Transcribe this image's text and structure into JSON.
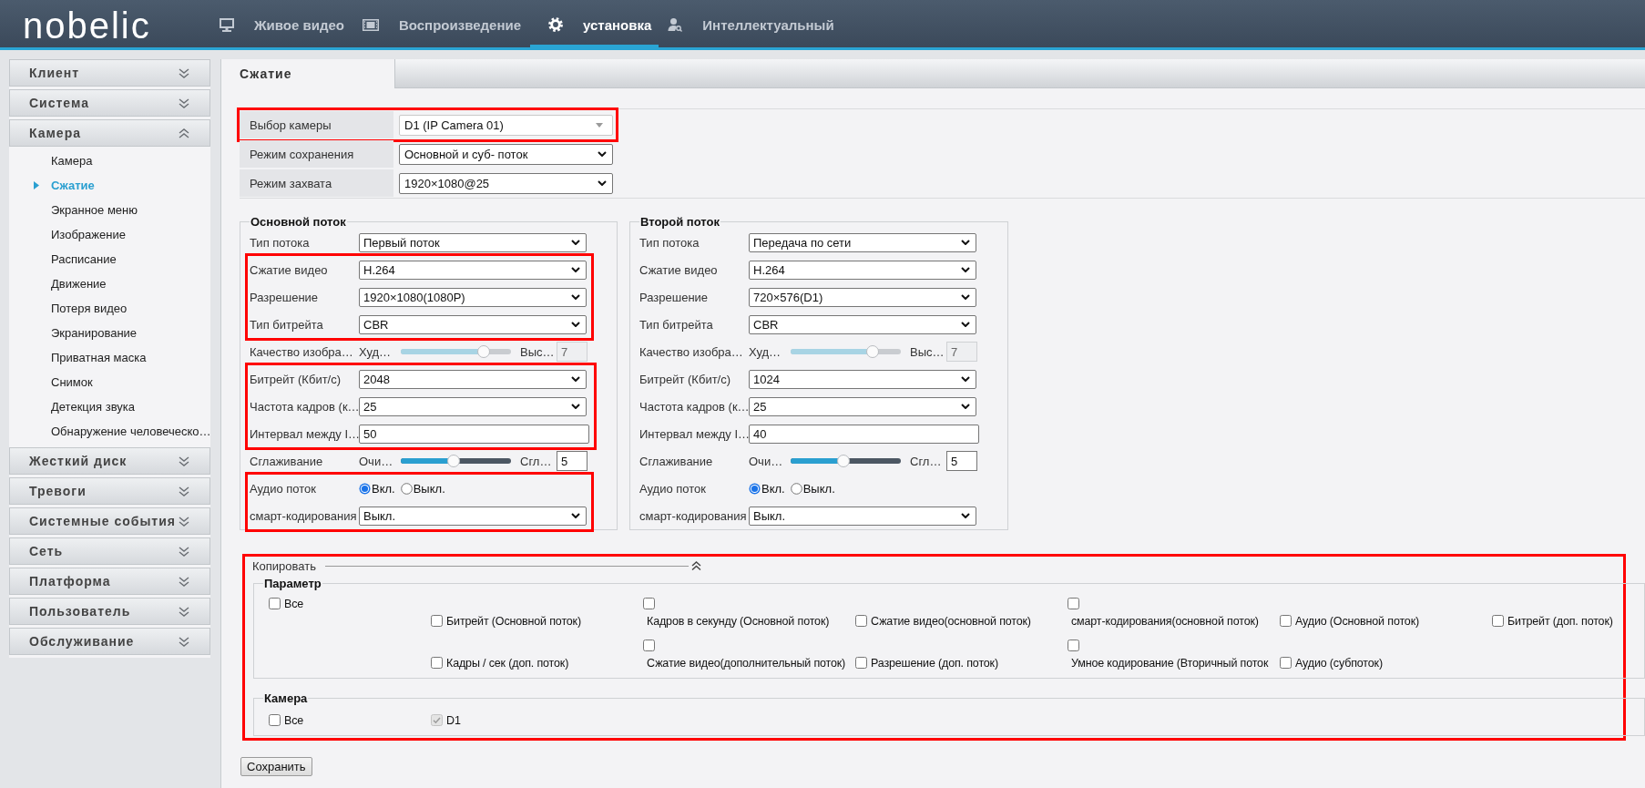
{
  "header": {
    "logo": "nobelic",
    "nav": [
      {
        "label": "Живое видео",
        "kind": "live",
        "selected": false
      },
      {
        "label": "Воспроизведение",
        "kind": "playback",
        "selected": false
      },
      {
        "label": "установка",
        "kind": "setup",
        "selected": true
      },
      {
        "label": "Интеллектуальный",
        "kind": "smart",
        "selected": false
      }
    ]
  },
  "sidebar": {
    "sections": [
      {
        "label": "Клиент",
        "expanded": false
      },
      {
        "label": "Система",
        "expanded": false
      },
      {
        "label": "Камера",
        "expanded": true,
        "items": [
          {
            "label": "Камера",
            "selected": false
          },
          {
            "label": "Сжатие",
            "selected": true
          },
          {
            "label": "Экранное меню",
            "selected": false
          },
          {
            "label": "Изображение",
            "selected": false
          },
          {
            "label": "Расписание",
            "selected": false
          },
          {
            "label": "Движение",
            "selected": false
          },
          {
            "label": "Потеря видео",
            "selected": false
          },
          {
            "label": "Экранирование",
            "selected": false
          },
          {
            "label": "Приватная маска",
            "selected": false
          },
          {
            "label": "Снимок",
            "selected": false
          },
          {
            "label": "Детекция звука",
            "selected": false
          },
          {
            "label": "Обнаружение человеческо…",
            "selected": false
          }
        ]
      },
      {
        "label": "Жесткий диск",
        "expanded": false
      },
      {
        "label": "Тревоги",
        "expanded": false
      },
      {
        "label": "Системные события",
        "expanded": false
      },
      {
        "label": "Сеть",
        "expanded": false
      },
      {
        "label": "Платформа",
        "expanded": false
      },
      {
        "label": "Пользователь",
        "expanded": false
      },
      {
        "label": "Обслуживание",
        "expanded": false
      }
    ]
  },
  "tabs": [
    {
      "label": "Сжатие",
      "selected": true
    }
  ],
  "general": {
    "groups": [
      {
        "highlighted": true,
        "rows": [
          {
            "kind": "combo",
            "label": "Выбор камеры",
            "value": "D1 (IP Camera 01)"
          }
        ]
      },
      {
        "highlighted": false,
        "rows": [
          {
            "kind": "select",
            "label": "Режим сохранения",
            "value": "Основной и суб- поток"
          },
          {
            "kind": "select",
            "label": "Режим захвата",
            "value": "1920×1080@25"
          }
        ]
      }
    ]
  },
  "streams": [
    {
      "title": "Основной поток",
      "groups": [
        {
          "highlighted": false,
          "rows": [
            {
              "kind": "select",
              "label": "Тип потока",
              "value": "Первый поток"
            }
          ]
        },
        {
          "highlighted": true,
          "rows": [
            {
              "kind": "select",
              "label": "Сжатие видео",
              "value": "H.264"
            },
            {
              "kind": "select",
              "label": "Разрешение",
              "value": "1920×1080(1080P)"
            },
            {
              "kind": "select",
              "label": "Тип битрейта",
              "value": "CBR"
            }
          ]
        },
        {
          "highlighted": false,
          "rows": [
            {
              "kind": "slider",
              "label": "Качество изобра…",
              "min_label": "Худ…",
              "max_label": "Выс…",
              "level": 0.75,
              "value": "7",
              "disabled": true
            }
          ]
        },
        {
          "highlighted": true,
          "rows": [
            {
              "kind": "select",
              "label": "Битрейт (Кбит/с)",
              "value": "2048"
            },
            {
              "kind": "select",
              "label": "Частота кадров (к…",
              "value": "25"
            },
            {
              "kind": "input",
              "label": "Интервал между I…",
              "value": "50"
            }
          ]
        },
        {
          "highlighted": false,
          "rows": [
            {
              "kind": "slider",
              "label": "Сглаживание",
              "min_label": "Очи…",
              "max_label": "Сгл…",
              "level": 0.48,
              "value": "5",
              "disabled": false
            }
          ]
        },
        {
          "highlighted": true,
          "rows": [
            {
              "kind": "radio",
              "label": "Аудио поток",
              "options": [
                {
                  "label": "Вкл.",
                  "selected": true
                },
                {
                  "label": "Выкл.",
                  "selected": false
                }
              ]
            },
            {
              "kind": "select",
              "label": "смарт-кодирования",
              "value": "Выкл."
            }
          ]
        }
      ]
    },
    {
      "title": "Второй поток",
      "groups": [
        {
          "highlighted": false,
          "rows": [
            {
              "kind": "select",
              "label": "Тип потока",
              "value": "Передача по сети"
            }
          ]
        },
        {
          "highlighted": false,
          "rows": [
            {
              "kind": "select",
              "label": "Сжатие видео",
              "value": "H.264"
            },
            {
              "kind": "select",
              "label": "Разрешение",
              "value": "720×576(D1)"
            },
            {
              "kind": "select",
              "label": "Тип битрейта",
              "value": "CBR"
            }
          ]
        },
        {
          "highlighted": false,
          "rows": [
            {
              "kind": "slider",
              "label": "Качество изобра…",
              "min_label": "Худ…",
              "max_label": "Выс…",
              "level": 0.74,
              "value": "7",
              "disabled": true
            }
          ]
        },
        {
          "highlighted": false,
          "rows": [
            {
              "kind": "select",
              "label": "Битрейт (Кбит/с)",
              "value": "1024"
            },
            {
              "kind": "select",
              "label": "Частота кадров (к…",
              "value": "25"
            },
            {
              "kind": "input",
              "label": "Интервал между I…",
              "value": "40"
            }
          ]
        },
        {
          "highlighted": false,
          "rows": [
            {
              "kind": "slider",
              "label": "Сглаживание",
              "min_label": "Очи…",
              "max_label": "Сгл…",
              "level": 0.48,
              "value": "5",
              "disabled": false
            }
          ]
        },
        {
          "highlighted": false,
          "rows": [
            {
              "kind": "radio",
              "label": "Аудио поток",
              "options": [
                {
                  "label": "Вкл.",
                  "selected": true
                },
                {
                  "label": "Выкл.",
                  "selected": false
                }
              ]
            },
            {
              "kind": "select",
              "label": "смарт-кодирования",
              "value": "Выкл."
            }
          ]
        }
      ]
    }
  ],
  "copy": {
    "highlighted": true,
    "title": "Копировать",
    "expanded": true,
    "parameters": {
      "title": "Параметр",
      "items": [
        {
          "label": "Все",
          "checked": false
        },
        {
          "label": "Битрейт (Основной поток)",
          "checked": false
        },
        {
          "label": "Кадров в секунду (Основной поток)",
          "checked": false
        },
        {
          "label": "Сжатие видео(основной поток)",
          "checked": false
        },
        {
          "label": "смарт-кодирования(основной поток)",
          "checked": false
        },
        {
          "label": "Аудио (Основной поток)",
          "checked": false
        },
        {
          "label": "Битрейт (доп. поток)",
          "checked": false
        },
        {
          "label": "Кадры / сек (доп. поток)",
          "checked": false
        },
        {
          "label": "Сжатие видео(дополнительный поток)",
          "checked": false
        },
        {
          "label": "Разрешение (доп. поток)",
          "checked": false
        },
        {
          "label": "Умное кодирование (Вторичный поток",
          "checked": false
        },
        {
          "label": "Аудио (субпоток)",
          "checked": false
        }
      ]
    },
    "camera": {
      "title": "Камера",
      "items": [
        {
          "label": "Все",
          "checked": false,
          "disabled": false
        },
        {
          "label": "D1",
          "checked": true,
          "disabled": true
        }
      ]
    }
  },
  "save_button": "Сохранить"
}
